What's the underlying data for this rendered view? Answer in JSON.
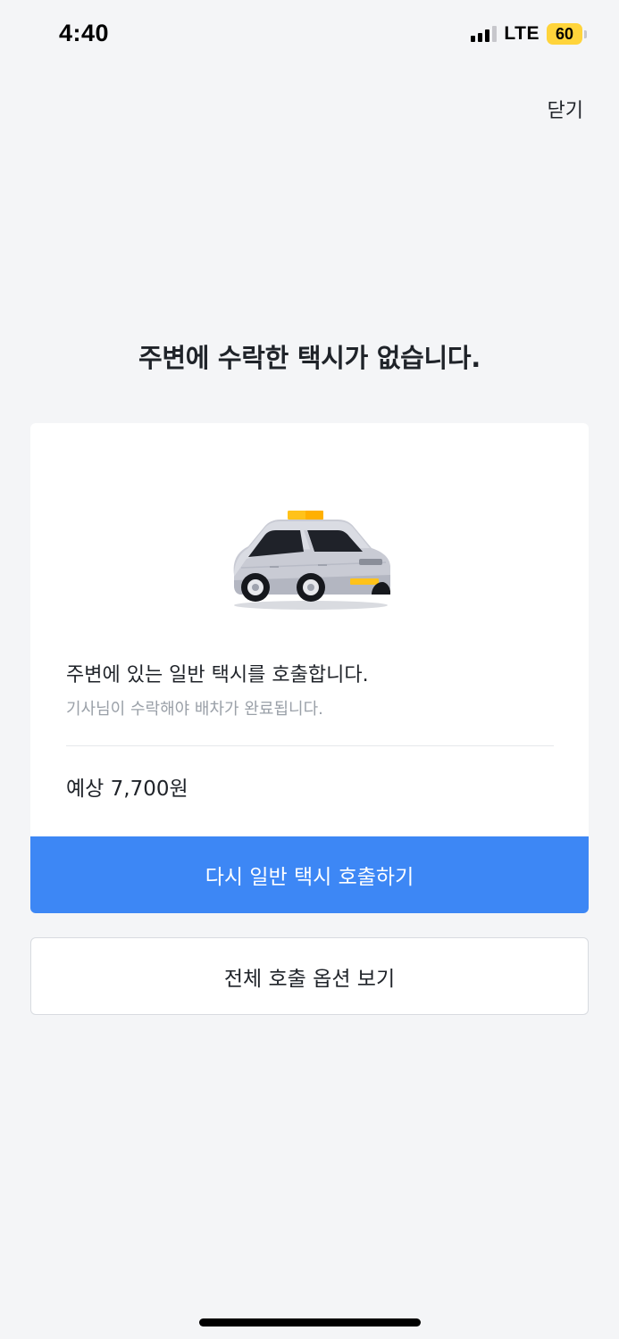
{
  "status_bar": {
    "time": "4:40",
    "network": "LTE",
    "battery": "60"
  },
  "header": {
    "close_label": "닫기"
  },
  "main": {
    "title": "주변에 수락한 택시가 없습니다."
  },
  "card": {
    "illustration_icon": "taxi-icon",
    "description": "주변에 있는 일반 택시를 호출합니다.",
    "subdescription": "기사님이 수락해야 배차가 완료됩니다.",
    "fare": "예상 7,700원",
    "primary_button_label": "다시 일반 택시 호출하기"
  },
  "secondary_button_label": "전체 호출 옵션 보기",
  "colors": {
    "accent": "#3d87f5",
    "battery": "#ffd43b",
    "background": "#f4f5f7"
  }
}
